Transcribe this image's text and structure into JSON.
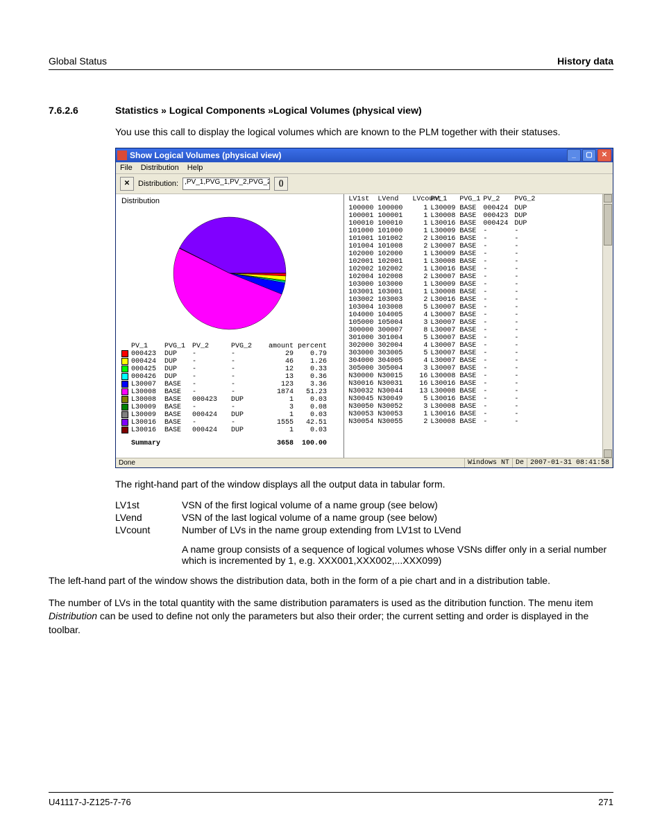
{
  "header": {
    "left": "Global Status",
    "right": "History data"
  },
  "section": {
    "number": "7.6.2.6",
    "title": "Statistics » Logical Components »Logical Volumes (physical view)"
  },
  "intro": "You use this call to display the logical volumes which are known to the PLM together with their statuses.",
  "window": {
    "title": "Show Logical Volumes (physical view)",
    "menu": [
      "File",
      "Distribution",
      "Help"
    ],
    "toolbar": {
      "distribution_label": "Distribution:",
      "distribution_value": ",PV_1,PVG_1,PV_2,PVG_2"
    },
    "left": {
      "title": "Distribution",
      "legend_headers": {
        "pv1": "PV_1",
        "pvg1": "PVG_1",
        "pv2": "PV_2",
        "pvg2": "PVG_2",
        "amount": "amount",
        "percent": "percent"
      },
      "legend": [
        {
          "color": "#ff0000",
          "pv1": "000423",
          "pvg1": "DUP",
          "pv2": "-",
          "pvg2": "-",
          "amount": "29",
          "percent": "0.79"
        },
        {
          "color": "#ffff00",
          "pv1": "000424",
          "pvg1": "DUP",
          "pv2": "-",
          "pvg2": "-",
          "amount": "46",
          "percent": "1.26"
        },
        {
          "color": "#00ff00",
          "pv1": "000425",
          "pvg1": "DUP",
          "pv2": "-",
          "pvg2": "-",
          "amount": "12",
          "percent": "0.33"
        },
        {
          "color": "#00ffff",
          "pv1": "000426",
          "pvg1": "DUP",
          "pv2": "-",
          "pvg2": "-",
          "amount": "13",
          "percent": "0.36"
        },
        {
          "color": "#0000ff",
          "pv1": "L30007",
          "pvg1": "BASE",
          "pv2": "-",
          "pvg2": "-",
          "amount": "123",
          "percent": "3.36"
        },
        {
          "color": "#ff00ff",
          "pv1": "L30008",
          "pvg1": "BASE",
          "pv2": "-",
          "pvg2": "-",
          "amount": "1874",
          "percent": "51.23"
        },
        {
          "color": "#808000",
          "pv1": "L30008",
          "pvg1": "BASE",
          "pv2": "000423",
          "pvg2": "DUP",
          "amount": "1",
          "percent": "0.03"
        },
        {
          "color": "#008000",
          "pv1": "L30009",
          "pvg1": "BASE",
          "pv2": "-",
          "pvg2": "-",
          "amount": "3",
          "percent": "0.08"
        },
        {
          "color": "#808080",
          "pv1": "L30009",
          "pvg1": "BASE",
          "pv2": "000424",
          "pvg2": "DUP",
          "amount": "1",
          "percent": "0.03"
        },
        {
          "color": "#8000ff",
          "pv1": "L30016",
          "pvg1": "BASE",
          "pv2": "-",
          "pvg2": "-",
          "amount": "1555",
          "percent": "42.51"
        },
        {
          "color": "#800000",
          "pv1": "L30016",
          "pvg1": "BASE",
          "pv2": "000424",
          "pvg2": "DUP",
          "amount": "1",
          "percent": "0.03"
        }
      ],
      "summary": {
        "label": "Summary",
        "amount": "3658",
        "percent": "100.00"
      }
    },
    "right": {
      "headers": {
        "lv1": "LV1st",
        "lvend": "LVend",
        "count": "LVcount",
        "pv1": "PV_1",
        "pvg1": "PVG_1",
        "pv2": "PV_2",
        "pvg2": "PVG_2"
      },
      "rows": [
        {
          "lv1": "100000",
          "lvend": "100000",
          "count": "1",
          "pv1": "L30009",
          "pvg1": "BASE",
          "pv2": "000424",
          "pvg2": "DUP"
        },
        {
          "lv1": "100001",
          "lvend": "100001",
          "count": "1",
          "pv1": "L30008",
          "pvg1": "BASE",
          "pv2": "000423",
          "pvg2": "DUP"
        },
        {
          "lv1": "100010",
          "lvend": "100010",
          "count": "1",
          "pv1": "L30016",
          "pvg1": "BASE",
          "pv2": "000424",
          "pvg2": "DUP"
        },
        {
          "lv1": "101000",
          "lvend": "101000",
          "count": "1",
          "pv1": "L30009",
          "pvg1": "BASE",
          "pv2": "-",
          "pvg2": "-"
        },
        {
          "lv1": "101001",
          "lvend": "101002",
          "count": "2",
          "pv1": "L30016",
          "pvg1": "BASE",
          "pv2": "-",
          "pvg2": "-"
        },
        {
          "lv1": "101004",
          "lvend": "101008",
          "count": "2",
          "pv1": "L30007",
          "pvg1": "BASE",
          "pv2": "-",
          "pvg2": "-"
        },
        {
          "lv1": "102000",
          "lvend": "102000",
          "count": "1",
          "pv1": "L30009",
          "pvg1": "BASE",
          "pv2": "-",
          "pvg2": "-"
        },
        {
          "lv1": "102001",
          "lvend": "102001",
          "count": "1",
          "pv1": "L30008",
          "pvg1": "BASE",
          "pv2": "-",
          "pvg2": "-"
        },
        {
          "lv1": "102002",
          "lvend": "102002",
          "count": "1",
          "pv1": "L30016",
          "pvg1": "BASE",
          "pv2": "-",
          "pvg2": "-"
        },
        {
          "lv1": "102004",
          "lvend": "102008",
          "count": "2",
          "pv1": "L30007",
          "pvg1": "BASE",
          "pv2": "-",
          "pvg2": "-"
        },
        {
          "lv1": "103000",
          "lvend": "103000",
          "count": "1",
          "pv1": "L30009",
          "pvg1": "BASE",
          "pv2": "-",
          "pvg2": "-"
        },
        {
          "lv1": "103001",
          "lvend": "103001",
          "count": "1",
          "pv1": "L30008",
          "pvg1": "BASE",
          "pv2": "-",
          "pvg2": "-"
        },
        {
          "lv1": "103002",
          "lvend": "103003",
          "count": "2",
          "pv1": "L30016",
          "pvg1": "BASE",
          "pv2": "-",
          "pvg2": "-"
        },
        {
          "lv1": "103004",
          "lvend": "103008",
          "count": "5",
          "pv1": "L30007",
          "pvg1": "BASE",
          "pv2": "-",
          "pvg2": "-"
        },
        {
          "lv1": "104000",
          "lvend": "104005",
          "count": "4",
          "pv1": "L30007",
          "pvg1": "BASE",
          "pv2": "-",
          "pvg2": "-"
        },
        {
          "lv1": "105000",
          "lvend": "105004",
          "count": "3",
          "pv1": "L30007",
          "pvg1": "BASE",
          "pv2": "-",
          "pvg2": "-"
        },
        {
          "lv1": "300000",
          "lvend": "300007",
          "count": "8",
          "pv1": "L30007",
          "pvg1": "BASE",
          "pv2": "-",
          "pvg2": "-"
        },
        {
          "lv1": "301000",
          "lvend": "301004",
          "count": "5",
          "pv1": "L30007",
          "pvg1": "BASE",
          "pv2": "-",
          "pvg2": "-"
        },
        {
          "lv1": "302000",
          "lvend": "302004",
          "count": "4",
          "pv1": "L30007",
          "pvg1": "BASE",
          "pv2": "-",
          "pvg2": "-"
        },
        {
          "lv1": "303000",
          "lvend": "303005",
          "count": "5",
          "pv1": "L30007",
          "pvg1": "BASE",
          "pv2": "-",
          "pvg2": "-"
        },
        {
          "lv1": "304000",
          "lvend": "304005",
          "count": "4",
          "pv1": "L30007",
          "pvg1": "BASE",
          "pv2": "-",
          "pvg2": "-"
        },
        {
          "lv1": "305000",
          "lvend": "305004",
          "count": "3",
          "pv1": "L30007",
          "pvg1": "BASE",
          "pv2": "-",
          "pvg2": "-"
        },
        {
          "lv1": "N30000",
          "lvend": "N30015",
          "count": "16",
          "pv1": "L30008",
          "pvg1": "BASE",
          "pv2": "-",
          "pvg2": "-"
        },
        {
          "lv1": "N30016",
          "lvend": "N30031",
          "count": "16",
          "pv1": "L30016",
          "pvg1": "BASE",
          "pv2": "-",
          "pvg2": "-"
        },
        {
          "lv1": "N30032",
          "lvend": "N30044",
          "count": "13",
          "pv1": "L30008",
          "pvg1": "BASE",
          "pv2": "-",
          "pvg2": "-"
        },
        {
          "lv1": "N30045",
          "lvend": "N30049",
          "count": "5",
          "pv1": "L30016",
          "pvg1": "BASE",
          "pv2": "-",
          "pvg2": "-"
        },
        {
          "lv1": "N30050",
          "lvend": "N30052",
          "count": "3",
          "pv1": "L30008",
          "pvg1": "BASE",
          "pv2": "-",
          "pvg2": "-"
        },
        {
          "lv1": "N30053",
          "lvend": "N30053",
          "count": "1",
          "pv1": "L30016",
          "pvg1": "BASE",
          "pv2": "-",
          "pvg2": "-"
        },
        {
          "lv1": "N30054",
          "lvend": "N30055",
          "count": "2",
          "pv1": "L30008",
          "pvg1": "BASE",
          "pv2": "-",
          "pvg2": "-"
        }
      ]
    },
    "status": {
      "done": "Done",
      "os": "Windows NT",
      "locale": "De",
      "ts": "2007-01-31 08:41:58"
    }
  },
  "after_window_1": "The right-hand part of the window displays all the output data in tabular form.",
  "defs": [
    {
      "term": "LV1st",
      "desc": "VSN of the first logical volume of a name group (see below)"
    },
    {
      "term": "LVend",
      "desc": "VSN of the last logical volume of a name group (see below)"
    },
    {
      "term": "LVcount",
      "desc": "Number of LVs in the name group extending from LV1st to LVend"
    }
  ],
  "name_group_note": "A name group consists of a sequence of logical volumes whose VSNs differ only in a serial number which is incremented by 1, e.g. XXX001,XXX002,...XXX099)",
  "after_window_2": "The left-hand part of the window shows the distribution data, both in the form of a pie chart and in a distribution table.",
  "after_window_3a": "The number of LVs in the total quantity with the same distribution paramaters is used as the ditribution function. The menu item ",
  "after_window_3i": "Distribution",
  "after_window_3b": " can be used to define not only the parameters but also their order; the current setting and order is displayed in the toolbar.",
  "footer": {
    "docid": "U41117-J-Z125-7-76",
    "pagenum": "271"
  },
  "chart_data": {
    "type": "pie",
    "title": "Distribution",
    "series": [
      {
        "name": "000423 DUP",
        "value": 29,
        "percent": 0.79,
        "color": "#ff0000"
      },
      {
        "name": "000424 DUP",
        "value": 46,
        "percent": 1.26,
        "color": "#ffff00"
      },
      {
        "name": "000425 DUP",
        "value": 12,
        "percent": 0.33,
        "color": "#00ff00"
      },
      {
        "name": "000426 DUP",
        "value": 13,
        "percent": 0.36,
        "color": "#00ffff"
      },
      {
        "name": "L30007 BASE",
        "value": 123,
        "percent": 3.36,
        "color": "#0000ff"
      },
      {
        "name": "L30008 BASE",
        "value": 1874,
        "percent": 51.23,
        "color": "#ff00ff"
      },
      {
        "name": "L30008 BASE 000423 DUP",
        "value": 1,
        "percent": 0.03,
        "color": "#808000"
      },
      {
        "name": "L30009 BASE",
        "value": 3,
        "percent": 0.08,
        "color": "#008000"
      },
      {
        "name": "L30009 BASE 000424 DUP",
        "value": 1,
        "percent": 0.03,
        "color": "#808080"
      },
      {
        "name": "L30016 BASE",
        "value": 1555,
        "percent": 42.51,
        "color": "#8000ff"
      },
      {
        "name": "L30016 BASE 000424 DUP",
        "value": 1,
        "percent": 0.03,
        "color": "#800000"
      }
    ],
    "total": 3658
  }
}
